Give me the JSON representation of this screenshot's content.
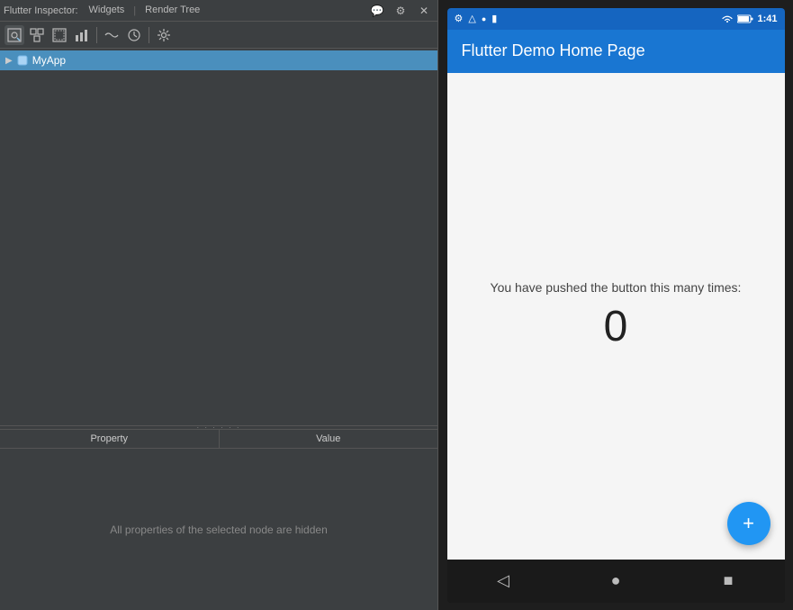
{
  "header": {
    "title": "Flutter Inspector:",
    "tabs": [
      "Widgets",
      "Render Tree"
    ],
    "separator": "|"
  },
  "toolbar": {
    "buttons": [
      {
        "id": "inspect",
        "icon": "🔍",
        "label": "inspect-icon",
        "active": true
      },
      {
        "id": "widget-tree",
        "icon": "▣",
        "label": "widget-tree-icon",
        "active": false
      },
      {
        "id": "render-tree",
        "icon": "⬚",
        "label": "render-tree-icon",
        "active": false
      },
      {
        "id": "perf",
        "icon": "▦",
        "label": "perf-icon",
        "active": false
      },
      {
        "id": "timeline",
        "icon": "〜",
        "label": "timeline-icon",
        "active": false
      },
      {
        "id": "clock",
        "icon": "⏱",
        "label": "clock-icon",
        "active": false
      },
      {
        "id": "settings",
        "icon": "⚙",
        "label": "settings-icon",
        "active": false
      }
    ]
  },
  "tree": {
    "items": [
      {
        "label": "MyApp",
        "icon": "M",
        "expanded": false,
        "selected": true
      }
    ]
  },
  "properties": {
    "col_property": "Property",
    "col_value": "Value",
    "empty_message": "All properties of the selected node are hidden"
  },
  "phone": {
    "status_bar": {
      "left_icons": [
        "⚙",
        "⚠",
        "○",
        "▮"
      ],
      "right_icons": [
        "▲",
        "🔋"
      ],
      "time": "1:41"
    },
    "app_bar_title": "Flutter Demo Home Page",
    "content": {
      "message": "You have pushed the button this many times:",
      "counter": "0"
    },
    "fab_icon": "+",
    "nav_buttons": [
      "◁",
      "●",
      "■"
    ]
  }
}
